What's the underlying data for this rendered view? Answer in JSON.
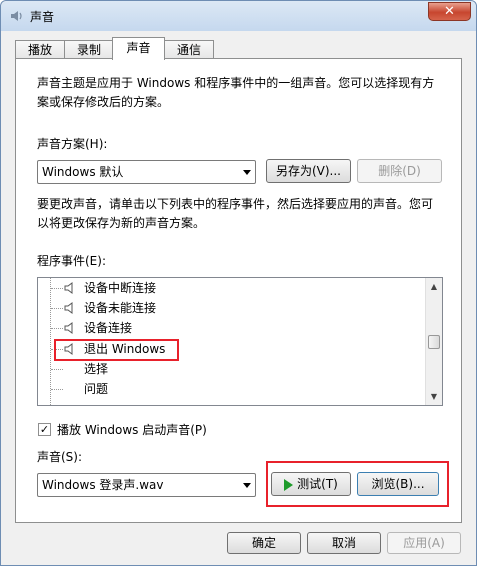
{
  "window": {
    "title": "声音",
    "close_label": "✕"
  },
  "tabs": [
    {
      "label": "播放",
      "active": false
    },
    {
      "label": "录制",
      "active": false
    },
    {
      "label": "声音",
      "active": true
    },
    {
      "label": "通信",
      "active": false
    }
  ],
  "intro_text": {
    "line1": "声音主题是应用于 Windows 和程序事件中的一组声音。您可以选择现有方",
    "line2": "案或保存修改后的方案。"
  },
  "scheme": {
    "label": "声音方案(H):",
    "selected": "Windows 默认",
    "save_as_label": "另存为(V)...",
    "delete_label": "删除(D)"
  },
  "change_text": {
    "line1": "要更改声音，请单击以下列表中的程序事件，然后选择要应用的声音。您可",
    "line2": "以将更改保存为新的声音方案。"
  },
  "events": {
    "label": "程序事件(E):",
    "items": [
      {
        "label": "设备中断连接",
        "has_sound": true
      },
      {
        "label": "设备未能连接",
        "has_sound": true
      },
      {
        "label": "设备连接",
        "has_sound": true
      },
      {
        "label": "退出 Windows",
        "has_sound": true
      },
      {
        "label": "选择",
        "has_sound": false
      },
      {
        "label": "问题",
        "has_sound": false
      }
    ]
  },
  "startup": {
    "checked": true,
    "check_mark": "✓",
    "label": "播放 Windows 启动声音(P)"
  },
  "sound": {
    "label": "声音(S):",
    "selected": "Windows 登录声.wav",
    "test_label": "测试(T)",
    "browse_label": "浏览(B)..."
  },
  "footer": {
    "ok_label": "确定",
    "cancel_label": "取消",
    "apply_label": "应用(A)"
  },
  "colors": {
    "highlight": "#e8212b",
    "play_icon": "#1d9b2a"
  }
}
